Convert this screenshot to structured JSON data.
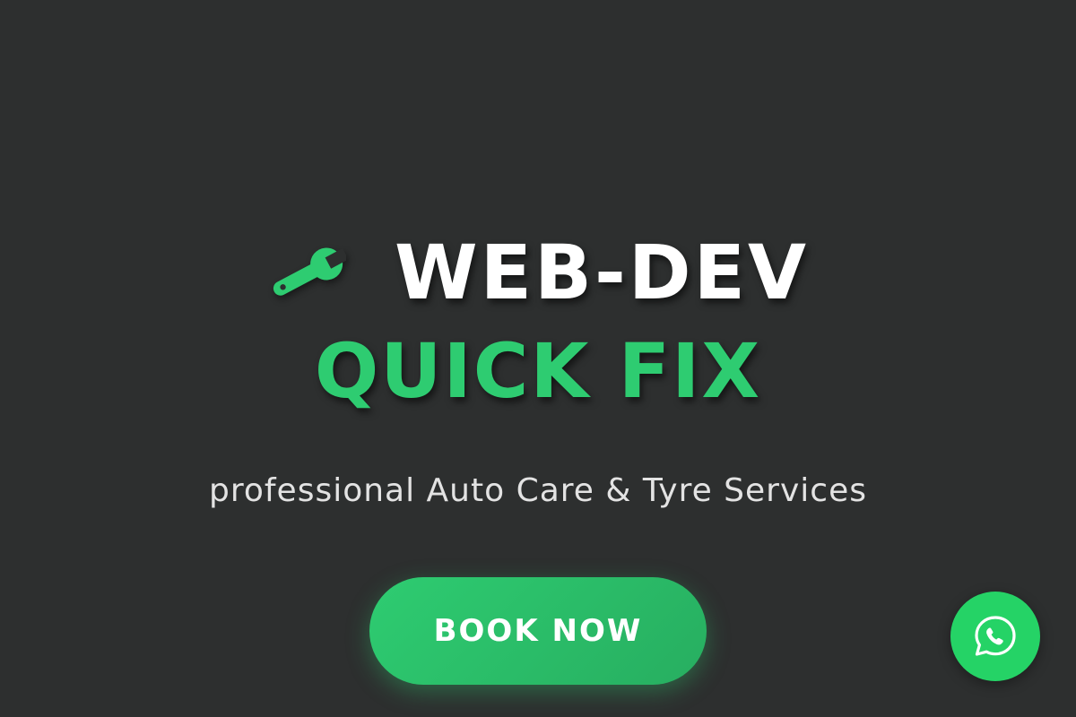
{
  "hero": {
    "brand_name": "WEB-DEV",
    "brand_tag": "QUICK FIX",
    "subtitle": "professional Auto Care & Tyre Services",
    "cta_label": "BOOK NOW",
    "icon": "wrench-icon"
  },
  "floating": {
    "icon": "whatsapp-icon"
  },
  "colors": {
    "background": "#2d2f2f",
    "accent": "#2ecc71",
    "whatsapp": "#25d366",
    "title": "#ffffff",
    "subtitle": "#e3e3e3"
  }
}
